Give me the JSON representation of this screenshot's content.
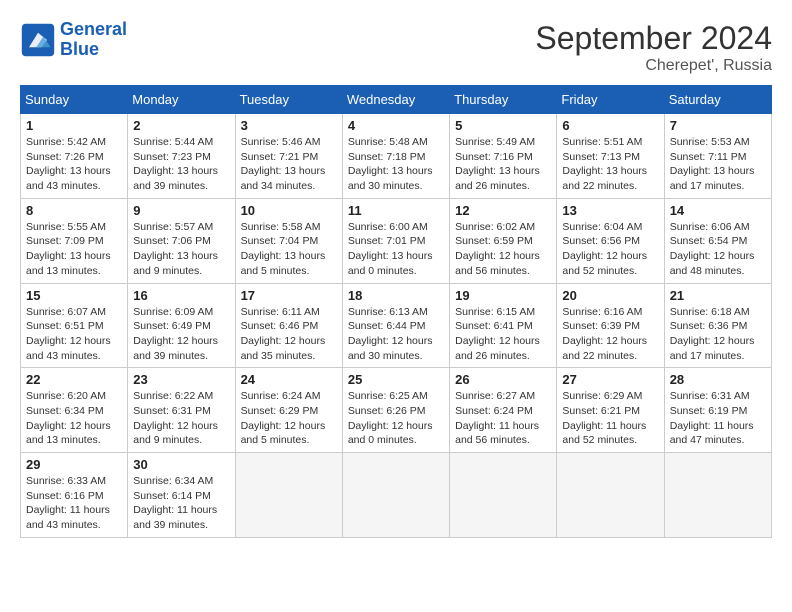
{
  "header": {
    "logo_line1": "General",
    "logo_line2": "Blue",
    "month_title": "September 2024",
    "location": "Cherepet', Russia"
  },
  "weekdays": [
    "Sunday",
    "Monday",
    "Tuesday",
    "Wednesday",
    "Thursday",
    "Friday",
    "Saturday"
  ],
  "weeks": [
    [
      {
        "day": 1,
        "info": "Sunrise: 5:42 AM\nSunset: 7:26 PM\nDaylight: 13 hours\nand 43 minutes."
      },
      {
        "day": 2,
        "info": "Sunrise: 5:44 AM\nSunset: 7:23 PM\nDaylight: 13 hours\nand 39 minutes."
      },
      {
        "day": 3,
        "info": "Sunrise: 5:46 AM\nSunset: 7:21 PM\nDaylight: 13 hours\nand 34 minutes."
      },
      {
        "day": 4,
        "info": "Sunrise: 5:48 AM\nSunset: 7:18 PM\nDaylight: 13 hours\nand 30 minutes."
      },
      {
        "day": 5,
        "info": "Sunrise: 5:49 AM\nSunset: 7:16 PM\nDaylight: 13 hours\nand 26 minutes."
      },
      {
        "day": 6,
        "info": "Sunrise: 5:51 AM\nSunset: 7:13 PM\nDaylight: 13 hours\nand 22 minutes."
      },
      {
        "day": 7,
        "info": "Sunrise: 5:53 AM\nSunset: 7:11 PM\nDaylight: 13 hours\nand 17 minutes."
      }
    ],
    [
      {
        "day": 8,
        "info": "Sunrise: 5:55 AM\nSunset: 7:09 PM\nDaylight: 13 hours\nand 13 minutes."
      },
      {
        "day": 9,
        "info": "Sunrise: 5:57 AM\nSunset: 7:06 PM\nDaylight: 13 hours\nand 9 minutes."
      },
      {
        "day": 10,
        "info": "Sunrise: 5:58 AM\nSunset: 7:04 PM\nDaylight: 13 hours\nand 5 minutes."
      },
      {
        "day": 11,
        "info": "Sunrise: 6:00 AM\nSunset: 7:01 PM\nDaylight: 13 hours\nand 0 minutes."
      },
      {
        "day": 12,
        "info": "Sunrise: 6:02 AM\nSunset: 6:59 PM\nDaylight: 12 hours\nand 56 minutes."
      },
      {
        "day": 13,
        "info": "Sunrise: 6:04 AM\nSunset: 6:56 PM\nDaylight: 12 hours\nand 52 minutes."
      },
      {
        "day": 14,
        "info": "Sunrise: 6:06 AM\nSunset: 6:54 PM\nDaylight: 12 hours\nand 48 minutes."
      }
    ],
    [
      {
        "day": 15,
        "info": "Sunrise: 6:07 AM\nSunset: 6:51 PM\nDaylight: 12 hours\nand 43 minutes."
      },
      {
        "day": 16,
        "info": "Sunrise: 6:09 AM\nSunset: 6:49 PM\nDaylight: 12 hours\nand 39 minutes."
      },
      {
        "day": 17,
        "info": "Sunrise: 6:11 AM\nSunset: 6:46 PM\nDaylight: 12 hours\nand 35 minutes."
      },
      {
        "day": 18,
        "info": "Sunrise: 6:13 AM\nSunset: 6:44 PM\nDaylight: 12 hours\nand 30 minutes."
      },
      {
        "day": 19,
        "info": "Sunrise: 6:15 AM\nSunset: 6:41 PM\nDaylight: 12 hours\nand 26 minutes."
      },
      {
        "day": 20,
        "info": "Sunrise: 6:16 AM\nSunset: 6:39 PM\nDaylight: 12 hours\nand 22 minutes."
      },
      {
        "day": 21,
        "info": "Sunrise: 6:18 AM\nSunset: 6:36 PM\nDaylight: 12 hours\nand 17 minutes."
      }
    ],
    [
      {
        "day": 22,
        "info": "Sunrise: 6:20 AM\nSunset: 6:34 PM\nDaylight: 12 hours\nand 13 minutes."
      },
      {
        "day": 23,
        "info": "Sunrise: 6:22 AM\nSunset: 6:31 PM\nDaylight: 12 hours\nand 9 minutes."
      },
      {
        "day": 24,
        "info": "Sunrise: 6:24 AM\nSunset: 6:29 PM\nDaylight: 12 hours\nand 5 minutes."
      },
      {
        "day": 25,
        "info": "Sunrise: 6:25 AM\nSunset: 6:26 PM\nDaylight: 12 hours\nand 0 minutes."
      },
      {
        "day": 26,
        "info": "Sunrise: 6:27 AM\nSunset: 6:24 PM\nDaylight: 11 hours\nand 56 minutes."
      },
      {
        "day": 27,
        "info": "Sunrise: 6:29 AM\nSunset: 6:21 PM\nDaylight: 11 hours\nand 52 minutes."
      },
      {
        "day": 28,
        "info": "Sunrise: 6:31 AM\nSunset: 6:19 PM\nDaylight: 11 hours\nand 47 minutes."
      }
    ],
    [
      {
        "day": 29,
        "info": "Sunrise: 6:33 AM\nSunset: 6:16 PM\nDaylight: 11 hours\nand 43 minutes."
      },
      {
        "day": 30,
        "info": "Sunrise: 6:34 AM\nSunset: 6:14 PM\nDaylight: 11 hours\nand 39 minutes."
      },
      null,
      null,
      null,
      null,
      null
    ]
  ]
}
